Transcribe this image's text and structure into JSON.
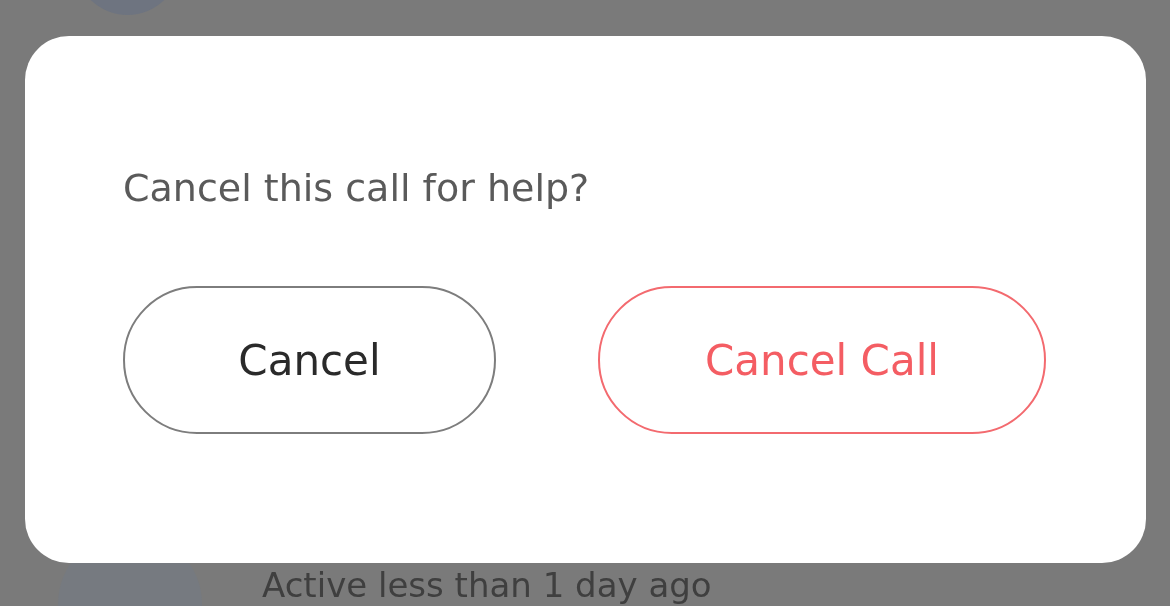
{
  "background_list": {
    "items": [
      {
        "kind": "avatar-only"
      },
      {
        "kind": "with-status",
        "status": "Active less than 1 day ago"
      }
    ]
  },
  "dialog": {
    "message": "Cancel this call for help?",
    "buttons": [
      {
        "label": "Cancel",
        "kind": "secondary"
      },
      {
        "label": "Cancel Call",
        "kind": "destructive"
      }
    ]
  }
}
